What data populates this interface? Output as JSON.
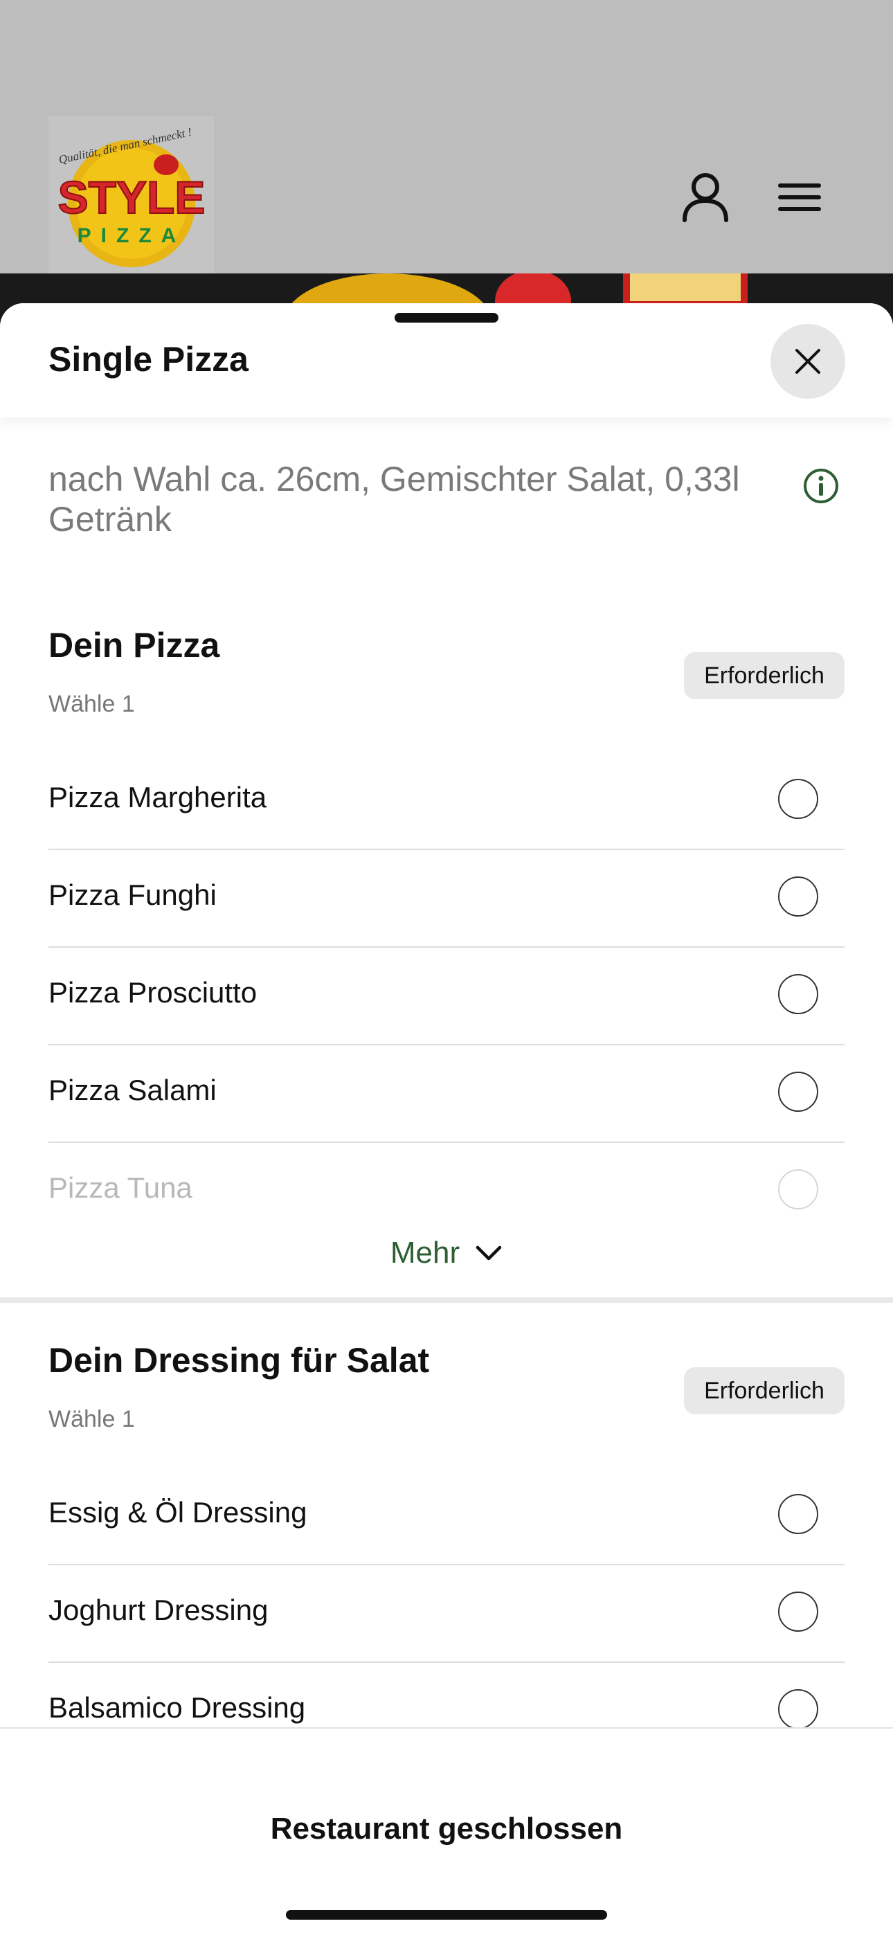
{
  "app": {
    "logo": {
      "tagline": "Qualität, die man schmeckt !",
      "brand_top": "STYLE",
      "brand_bottom": "PIZZA"
    },
    "header_icons": [
      "user-icon",
      "menu-icon"
    ]
  },
  "sheet": {
    "title": "Single Pizza",
    "description": "nach Wahl ca. 26cm, Gemischter Salat, 0,33l Getränk",
    "sections": [
      {
        "title": "Dein Pizza",
        "subtitle": "Wähle 1",
        "badge": "Erforderlich",
        "options": [
          "Pizza Margherita",
          "Pizza Funghi",
          "Pizza Prosciutto",
          "Pizza Salami",
          "Pizza Tuna"
        ],
        "more_label": "Mehr"
      },
      {
        "title": "Dein Dressing für Salat",
        "subtitle": "Wähle 1",
        "badge": "Erforderlich",
        "options": [
          "Essig & Öl Dressing",
          "Joghurt Dressing",
          "Balsamico Dressing"
        ]
      }
    ]
  },
  "footer": {
    "status": "Restaurant geschlossen"
  },
  "colors": {
    "accent_green": "#2e5e34",
    "badge_bg": "#e8e8e8",
    "logo_red": "#d6262b",
    "logo_yellow": "#f2c418"
  }
}
